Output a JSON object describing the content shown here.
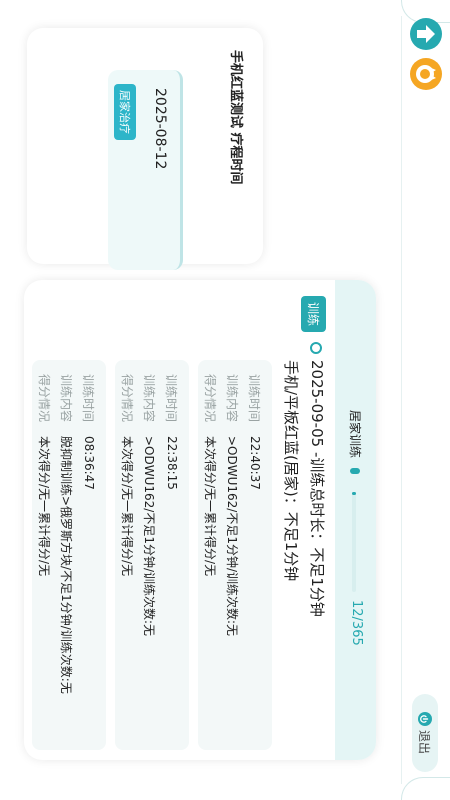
{
  "nav": {
    "up_icon": "up-arrow-icon",
    "face_icon": "face-icon",
    "up_color": "#26a9b0",
    "face_color": "#f5a623"
  },
  "exit": {
    "label": "退出",
    "icon": "exit-icon"
  },
  "schedule": {
    "title": "手机红蓝测试  疗程时间",
    "entries": [
      {
        "date": "2025-08-12",
        "tag": "居家治疗"
      }
    ]
  },
  "training": {
    "header_title": "居家训练",
    "progress_text": "12/365",
    "progress_fraction": 0.033,
    "tag": "训练",
    "headline": "2025-09-05 -训练总时长：不足1分钟",
    "subtitle": "手机/平板红蓝(居家)：不足1分钟",
    "labels": {
      "time": "训练时间",
      "content": "训练内容",
      "score": "得分情况"
    },
    "records": [
      {
        "time": "22:40:37",
        "content": ">ODWU162/不足1分钟/训练次数:无",
        "score": "本次得分/无一累计得分/无"
      },
      {
        "time": "22:38:15",
        "content": ">ODWU162/不足1分钟/训练次数:无",
        "score": "本次得分/无一累计得分/无"
      },
      {
        "time": "08:36:47",
        "content": "脱抑制训练>俄罗斯方块/不足1分钟/训练次数:无",
        "score": "本次得分/无一累计得分/无"
      }
    ]
  },
  "colors": {
    "accent": "#26a9b0",
    "accent_light": "#e4f5f5",
    "tag": "#2db5c9",
    "orange": "#f5a623"
  }
}
